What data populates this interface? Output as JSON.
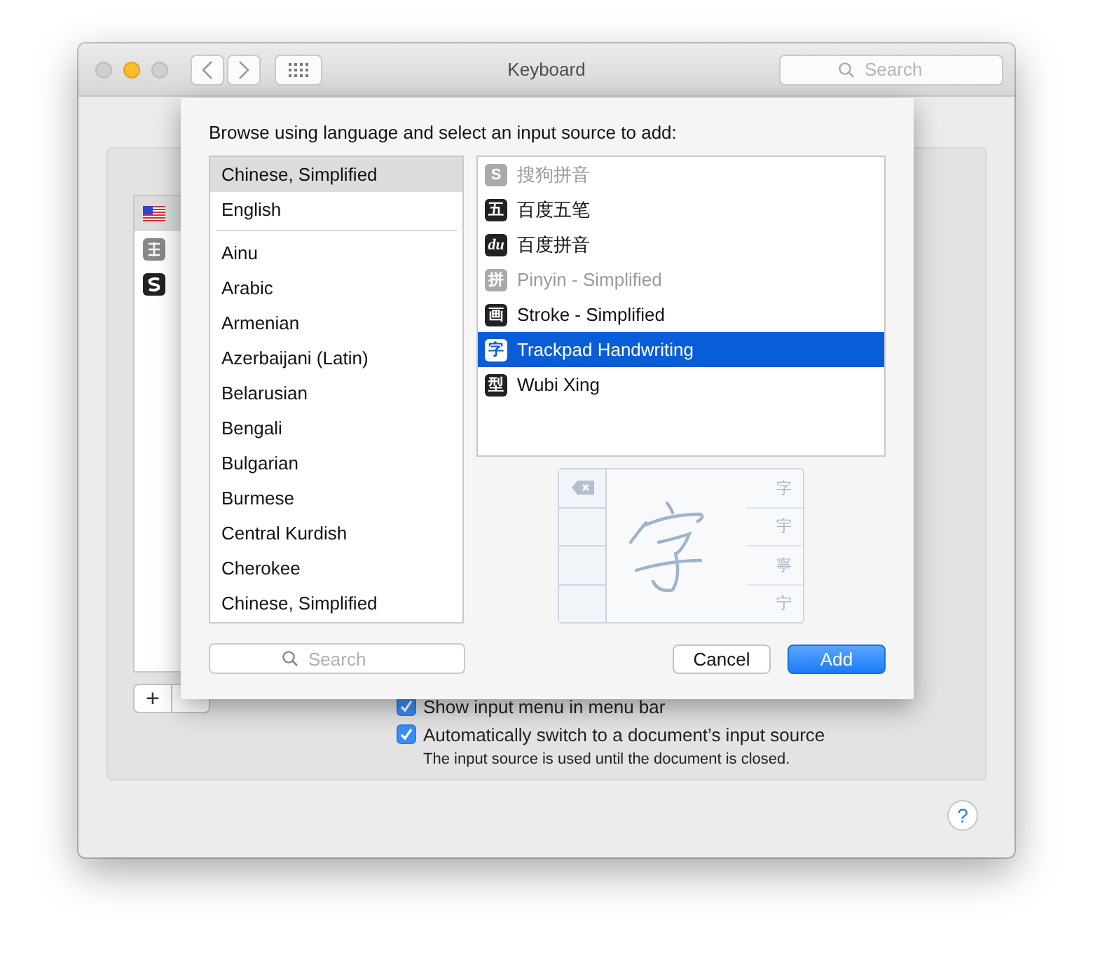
{
  "window": {
    "title": "Keyboard",
    "search_placeholder": "Search"
  },
  "background": {
    "sources": [
      {
        "kind": "flag",
        "selected": true
      },
      {
        "kind": "pinyin",
        "selected": false
      },
      {
        "kind": "sogou",
        "selected": false
      }
    ],
    "add_button": "+",
    "options": [
      {
        "label": "Show input menu in menu bar",
        "checked": true
      },
      {
        "label": "Automatically switch to a document’s input source",
        "checked": true,
        "note": "The input source is used until the document is closed."
      }
    ],
    "help": "?"
  },
  "sheet": {
    "prompt": "Browse using language and select an input source to add:",
    "languages": {
      "preferred": [
        {
          "label": "Chinese, Simplified",
          "selected": true
        },
        {
          "label": "English",
          "selected": false
        }
      ],
      "all": [
        {
          "label": "Ainu",
          "selected": false
        },
        {
          "label": "Arabic",
          "selected": false
        },
        {
          "label": "Armenian",
          "selected": false
        },
        {
          "label": "Azerbaijani (Latin)",
          "selected": false
        },
        {
          "label": "Belarusian",
          "selected": false
        },
        {
          "label": "Bengali",
          "selected": false
        },
        {
          "label": "Bulgarian",
          "selected": false
        },
        {
          "label": "Burmese",
          "selected": false
        },
        {
          "label": "Central Kurdish",
          "selected": false
        },
        {
          "label": "Cherokee",
          "selected": false
        },
        {
          "label": "Chinese, Simplified",
          "selected": false
        }
      ]
    },
    "sources": [
      {
        "icon": "S",
        "label": "搜狗拼音",
        "disabled": true,
        "selected": false
      },
      {
        "icon": "五",
        "label": "百度五笔",
        "disabled": false,
        "selected": false
      },
      {
        "icon": "du",
        "label": "百度拼音",
        "disabled": false,
        "selected": false
      },
      {
        "icon": "拼",
        "label": "Pinyin - Simplified",
        "disabled": true,
        "selected": false
      },
      {
        "icon": "画",
        "label": "Stroke - Simplified",
        "disabled": false,
        "selected": false
      },
      {
        "icon": "字",
        "label": "Trackpad Handwriting",
        "disabled": false,
        "selected": true
      },
      {
        "icon": "型",
        "label": "Wubi Xing",
        "disabled": false,
        "selected": false
      }
    ],
    "preview": {
      "candidates": [
        "字",
        "宇",
        "寧",
        "宁"
      ]
    },
    "search_placeholder": "Search",
    "buttons": [
      {
        "label": "Cancel",
        "kind": "secondary"
      },
      {
        "label": "Add",
        "kind": "primary"
      }
    ]
  }
}
